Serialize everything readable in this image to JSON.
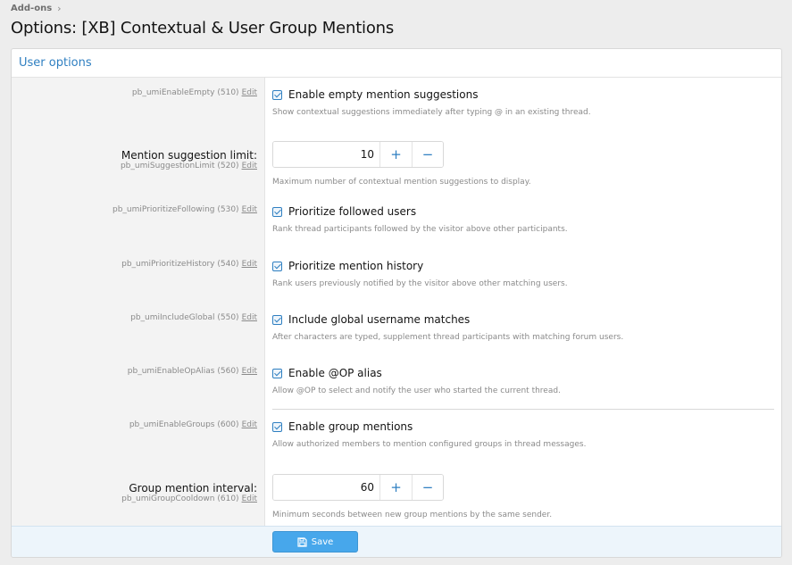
{
  "breadcrumb": {
    "items": [
      "Add-ons"
    ],
    "separator": "›"
  },
  "page": {
    "title": "Options: [XB] Contextual & User Group Mentions"
  },
  "section": {
    "title": "User options"
  },
  "edit_label": "Edit",
  "options": [
    {
      "key": "pb_umiEnableEmpty (510)",
      "type": "checkbox",
      "checked": true,
      "label": "Enable empty mention suggestions",
      "hint": "Show contextual suggestions immediately after typing @ in an existing thread."
    },
    {
      "key": "pb_umiSuggestionLimit (520)",
      "type": "spinner",
      "title": "Mention suggestion limit:",
      "value": "10",
      "hint": "Maximum number of contextual mention suggestions to display."
    },
    {
      "key": "pb_umiPrioritizeFollowing (530)",
      "type": "checkbox",
      "checked": true,
      "label": "Prioritize followed users",
      "hint": "Rank thread participants followed by the visitor above other participants."
    },
    {
      "key": "pb_umiPrioritizeHistory (540)",
      "type": "checkbox",
      "checked": true,
      "label": "Prioritize mention history",
      "hint": "Rank users previously notified by the visitor above other matching users."
    },
    {
      "key": "pb_umiIncludeGlobal (550)",
      "type": "checkbox",
      "checked": true,
      "label": "Include global username matches",
      "hint": "After characters are typed, supplement thread participants with matching forum users."
    },
    {
      "key": "pb_umiEnableOpAlias (560)",
      "type": "checkbox",
      "checked": true,
      "label": "Enable @OP alias",
      "hint": "Allow @OP to select and notify the user who started the current thread."
    },
    {
      "key": "pb_umiEnableGroups (600)",
      "type": "checkbox",
      "checked": true,
      "label": "Enable group mentions",
      "hint": "Allow authorized members to mention configured groups in thread messages."
    },
    {
      "key": "pb_umiGroupCooldown (610)",
      "type": "spinner",
      "title": "Group mention interval:",
      "value": "60",
      "hint": "Minimum seconds between new group mentions by the same sender."
    }
  ],
  "spinner": {
    "increment": "+",
    "decrement": "−"
  },
  "footer": {
    "save_label": "Save"
  },
  "colors": {
    "accent": "#2f7fc1",
    "button": "#47a7eb",
    "footer_bg": "#edf5fb"
  }
}
